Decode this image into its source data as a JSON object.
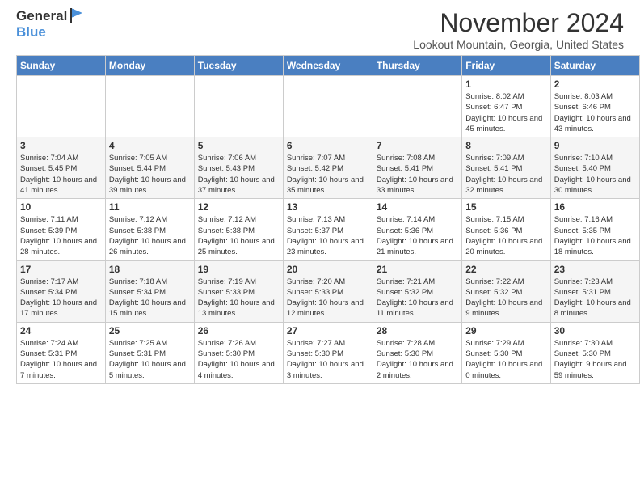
{
  "header": {
    "logo": {
      "general": "General",
      "blue": "Blue"
    },
    "title": "November 2024",
    "location": "Lookout Mountain, Georgia, United States"
  },
  "calendar": {
    "days_of_week": [
      "Sunday",
      "Monday",
      "Tuesday",
      "Wednesday",
      "Thursday",
      "Friday",
      "Saturday"
    ],
    "weeks": [
      [
        {
          "day": "",
          "info": ""
        },
        {
          "day": "",
          "info": ""
        },
        {
          "day": "",
          "info": ""
        },
        {
          "day": "",
          "info": ""
        },
        {
          "day": "",
          "info": ""
        },
        {
          "day": "1",
          "info": "Sunrise: 8:02 AM\nSunset: 6:47 PM\nDaylight: 10 hours and 45 minutes."
        },
        {
          "day": "2",
          "info": "Sunrise: 8:03 AM\nSunset: 6:46 PM\nDaylight: 10 hours and 43 minutes."
        }
      ],
      [
        {
          "day": "3",
          "info": "Sunrise: 7:04 AM\nSunset: 5:45 PM\nDaylight: 10 hours and 41 minutes."
        },
        {
          "day": "4",
          "info": "Sunrise: 7:05 AM\nSunset: 5:44 PM\nDaylight: 10 hours and 39 minutes."
        },
        {
          "day": "5",
          "info": "Sunrise: 7:06 AM\nSunset: 5:43 PM\nDaylight: 10 hours and 37 minutes."
        },
        {
          "day": "6",
          "info": "Sunrise: 7:07 AM\nSunset: 5:42 PM\nDaylight: 10 hours and 35 minutes."
        },
        {
          "day": "7",
          "info": "Sunrise: 7:08 AM\nSunset: 5:41 PM\nDaylight: 10 hours and 33 minutes."
        },
        {
          "day": "8",
          "info": "Sunrise: 7:09 AM\nSunset: 5:41 PM\nDaylight: 10 hours and 32 minutes."
        },
        {
          "day": "9",
          "info": "Sunrise: 7:10 AM\nSunset: 5:40 PM\nDaylight: 10 hours and 30 minutes."
        }
      ],
      [
        {
          "day": "10",
          "info": "Sunrise: 7:11 AM\nSunset: 5:39 PM\nDaylight: 10 hours and 28 minutes."
        },
        {
          "day": "11",
          "info": "Sunrise: 7:12 AM\nSunset: 5:38 PM\nDaylight: 10 hours and 26 minutes."
        },
        {
          "day": "12",
          "info": "Sunrise: 7:12 AM\nSunset: 5:38 PM\nDaylight: 10 hours and 25 minutes."
        },
        {
          "day": "13",
          "info": "Sunrise: 7:13 AM\nSunset: 5:37 PM\nDaylight: 10 hours and 23 minutes."
        },
        {
          "day": "14",
          "info": "Sunrise: 7:14 AM\nSunset: 5:36 PM\nDaylight: 10 hours and 21 minutes."
        },
        {
          "day": "15",
          "info": "Sunrise: 7:15 AM\nSunset: 5:36 PM\nDaylight: 10 hours and 20 minutes."
        },
        {
          "day": "16",
          "info": "Sunrise: 7:16 AM\nSunset: 5:35 PM\nDaylight: 10 hours and 18 minutes."
        }
      ],
      [
        {
          "day": "17",
          "info": "Sunrise: 7:17 AM\nSunset: 5:34 PM\nDaylight: 10 hours and 17 minutes."
        },
        {
          "day": "18",
          "info": "Sunrise: 7:18 AM\nSunset: 5:34 PM\nDaylight: 10 hours and 15 minutes."
        },
        {
          "day": "19",
          "info": "Sunrise: 7:19 AM\nSunset: 5:33 PM\nDaylight: 10 hours and 13 minutes."
        },
        {
          "day": "20",
          "info": "Sunrise: 7:20 AM\nSunset: 5:33 PM\nDaylight: 10 hours and 12 minutes."
        },
        {
          "day": "21",
          "info": "Sunrise: 7:21 AM\nSunset: 5:32 PM\nDaylight: 10 hours and 11 minutes."
        },
        {
          "day": "22",
          "info": "Sunrise: 7:22 AM\nSunset: 5:32 PM\nDaylight: 10 hours and 9 minutes."
        },
        {
          "day": "23",
          "info": "Sunrise: 7:23 AM\nSunset: 5:31 PM\nDaylight: 10 hours and 8 minutes."
        }
      ],
      [
        {
          "day": "24",
          "info": "Sunrise: 7:24 AM\nSunset: 5:31 PM\nDaylight: 10 hours and 7 minutes."
        },
        {
          "day": "25",
          "info": "Sunrise: 7:25 AM\nSunset: 5:31 PM\nDaylight: 10 hours and 5 minutes."
        },
        {
          "day": "26",
          "info": "Sunrise: 7:26 AM\nSunset: 5:30 PM\nDaylight: 10 hours and 4 minutes."
        },
        {
          "day": "27",
          "info": "Sunrise: 7:27 AM\nSunset: 5:30 PM\nDaylight: 10 hours and 3 minutes."
        },
        {
          "day": "28",
          "info": "Sunrise: 7:28 AM\nSunset: 5:30 PM\nDaylight: 10 hours and 2 minutes."
        },
        {
          "day": "29",
          "info": "Sunrise: 7:29 AM\nSunset: 5:30 PM\nDaylight: 10 hours and 0 minutes."
        },
        {
          "day": "30",
          "info": "Sunrise: 7:30 AM\nSunset: 5:30 PM\nDaylight: 9 hours and 59 minutes."
        }
      ]
    ]
  }
}
